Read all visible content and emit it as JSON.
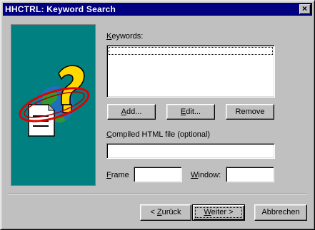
{
  "window": {
    "title": "HHCTRL: Keyword Search",
    "close_glyph": "×"
  },
  "icons": {
    "banner": "help-document-globe-icon",
    "close": "close-icon"
  },
  "keywords": {
    "label_mnemonic": "K",
    "label_rest": "eywords:",
    "items": []
  },
  "buttons": {
    "add": {
      "mnemonic": "A",
      "rest": "dd..."
    },
    "edit": {
      "mnemonic": "E",
      "rest": "dit..."
    },
    "remove": {
      "label": "Remove"
    }
  },
  "compiled": {
    "label_mnemonic": "C",
    "label_rest": "ompiled HTML file (optional)",
    "value": ""
  },
  "frame": {
    "label_mnemonic": "F",
    "label_rest": "rame",
    "value": ""
  },
  "window_field": {
    "label_mnemonic": "W",
    "label_rest": "indow:",
    "value": ""
  },
  "footer": {
    "back": {
      "prefix": "< ",
      "mnemonic": "Z",
      "rest": "urück"
    },
    "next": {
      "mnemonic": "W",
      "rest": "eiter >"
    },
    "cancel": {
      "label": "Abbrechen"
    }
  }
}
